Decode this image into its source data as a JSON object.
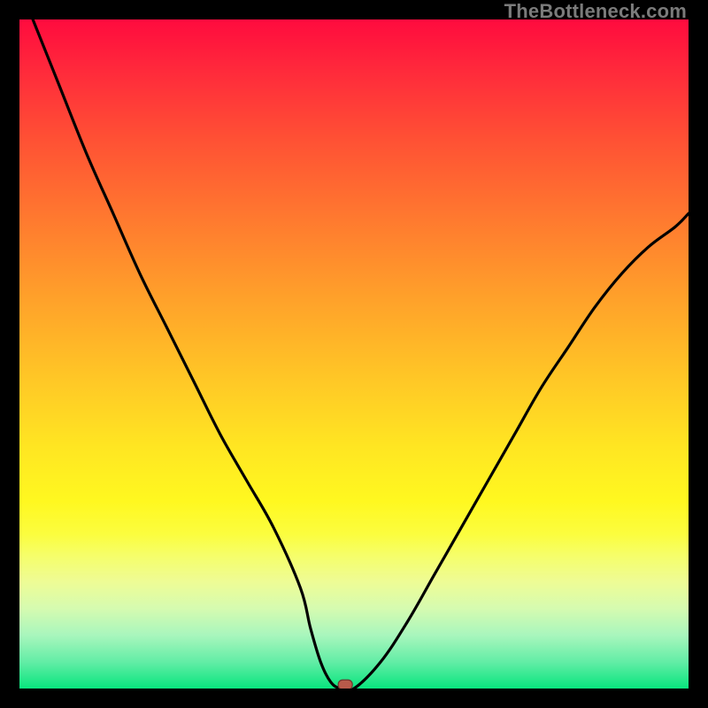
{
  "watermark": "TheBottleneck.com",
  "marker": {
    "color": "#b85a4a",
    "stroke": "#6c3a30"
  },
  "chart_data": {
    "type": "line",
    "title": "",
    "xlabel": "",
    "ylabel": "",
    "xlim": [
      0,
      100
    ],
    "ylim": [
      0,
      100
    ],
    "grid": false,
    "series": [
      {
        "name": "bottleneck-curve",
        "x": [
          2,
          6,
          10,
          14,
          18,
          22,
          26,
          30,
          34,
          38,
          42,
          43.5,
          45,
          46.5,
          48,
          50,
          54,
          58,
          62,
          66,
          70,
          74,
          78,
          82,
          86,
          90,
          94,
          98,
          100
        ],
        "y": [
          100,
          90,
          80,
          71,
          62,
          54,
          46,
          38,
          31,
          24,
          15,
          9,
          4,
          1,
          0,
          0,
          4,
          10,
          17,
          24,
          31,
          38,
          45,
          51,
          57,
          62,
          66,
          69,
          71
        ]
      }
    ],
    "marker_point": {
      "x": 48.7,
      "y": 0.5
    },
    "palette": {
      "top": "#ff0b3e",
      "mid": "#ffe622",
      "bottom": "#08e57e",
      "curve": "#000000"
    }
  }
}
